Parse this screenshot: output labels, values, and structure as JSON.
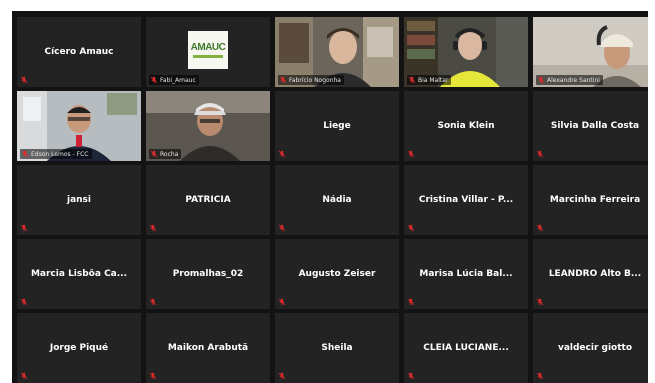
{
  "participants": [
    {
      "name": "Cícero Amauc",
      "video": false
    },
    {
      "name": "Fabi_Amauc",
      "video": false,
      "logo": true,
      "logo_text": "AMAUC"
    },
    {
      "name": "Fabrício Nogonha",
      "video": true
    },
    {
      "name": "Bia Maltar",
      "video": true,
      "speaking": true
    },
    {
      "name": "Alexandre Santini",
      "video": true
    },
    {
      "name": "Edson Lemos - FCC",
      "video": true
    },
    {
      "name": "Rocha",
      "video": true
    },
    {
      "name": "Liege",
      "video": false
    },
    {
      "name": "Sonia Klein",
      "video": false
    },
    {
      "name": "Silvia Dalla Costa",
      "video": false
    },
    {
      "name": "jansi",
      "video": false
    },
    {
      "name": "PATRICIA",
      "video": false
    },
    {
      "name": "Nádia",
      "video": false
    },
    {
      "name": "Cristina Villar - P...",
      "video": false
    },
    {
      "name": "Marcinha Ferreira",
      "video": false
    },
    {
      "name": "Marcia Lisbôa Ca...",
      "video": false
    },
    {
      "name": "Promalhas_02",
      "video": false
    },
    {
      "name": "Augusto Zeiser",
      "video": false
    },
    {
      "name": "Marisa Lúcia Bal...",
      "video": false
    },
    {
      "name": "LEANDRO Alto B...",
      "video": false
    },
    {
      "name": "Jorge Piqué",
      "video": false
    },
    {
      "name": "Maikon Arabutã",
      "video": false
    },
    {
      "name": "Sheila",
      "video": false
    },
    {
      "name": "CLÉIA LUCIANE...",
      "video": false
    },
    {
      "name": "valdecir giotto",
      "video": false
    }
  ],
  "colors": {
    "tile_bg": "#232323",
    "frame_bg": "#131313",
    "active_speaker": "#c9d93a",
    "muted_icon": "#e02a2a"
  },
  "icons": {
    "muted": "mic-muted-icon"
  }
}
